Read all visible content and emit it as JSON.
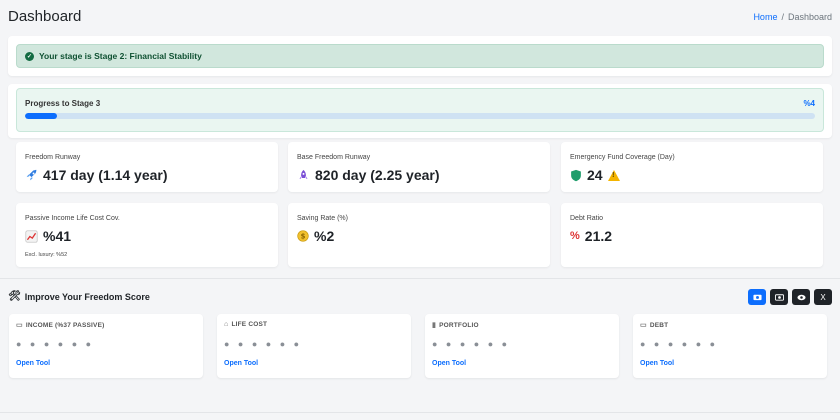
{
  "header": {
    "title": "Dashboard",
    "breadcrumb": {
      "home": "Home",
      "separator": "/",
      "current": "Dashboard"
    }
  },
  "stage": {
    "text": "Your stage is Stage 2: Financial Stability"
  },
  "progress": {
    "label": "Progress to Stage 3",
    "percent_text": "%4",
    "value": 0.04
  },
  "stats": [
    {
      "label": "Freedom Runway",
      "icon": "rocket-icon",
      "glyph": "🚀",
      "value": "417 day (1.14 year)"
    },
    {
      "label": "Base Freedom Runway",
      "icon": "rocket-purple-icon",
      "glyph": "🚀",
      "value": "820 day (2.25 year)"
    },
    {
      "label": "Emergency Fund Coverage (Day)",
      "icon": "shield-icon",
      "glyph": "",
      "value": "24"
    },
    {
      "label": "Passive Income Life Cost Cov.",
      "icon": "chart-up-icon",
      "glyph": "📈",
      "value": "%41",
      "note": "Excl. luxury: %52"
    },
    {
      "label": "Saving Rate (%)",
      "icon": "coin-icon",
      "glyph": "$",
      "value": "%2"
    },
    {
      "label": "Debt Ratio",
      "icon": "percent-icon",
      "glyph": "%",
      "value": "21.2"
    }
  ],
  "improve": {
    "title": "Improve Your Freedom Score",
    "icon": "tools-icon",
    "buttons": [
      {
        "name": "camera-button",
        "glyph": "📷"
      },
      {
        "name": "camera-alt-button",
        "glyph": "📷"
      },
      {
        "name": "eye-off-button",
        "glyph": "◉"
      },
      {
        "name": "x-button",
        "glyph": "X"
      }
    ],
    "tools": [
      {
        "title": "INCOME (%37 PASSIVE)",
        "icon": "wallet-icon",
        "glyph": "▭",
        "masked": "● ● ● ● ● ●",
        "link": "Open Tool"
      },
      {
        "title": "LIFE COST",
        "icon": "home-icon",
        "glyph": "⌂",
        "masked": "● ● ● ● ● ●",
        "link": "Open Tool"
      },
      {
        "title": "PORTFOLIO",
        "icon": "bar-chart-icon",
        "glyph": "▮",
        "masked": "● ● ● ● ● ●",
        "link": "Open Tool"
      },
      {
        "title": "DEBT",
        "icon": "card-icon",
        "glyph": "▭",
        "masked": "● ● ● ● ● ●",
        "link": "Open Tool"
      }
    ]
  },
  "colors": {
    "primary": "#0d6efd",
    "success_bg": "#d1e7dd",
    "success_text": "#0f5132",
    "warning": "#f4b400"
  }
}
